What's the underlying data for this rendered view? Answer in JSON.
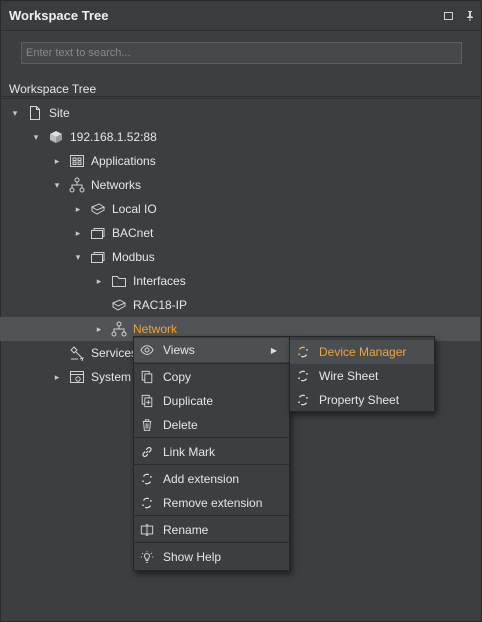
{
  "panel": {
    "title": "Workspace Tree",
    "search_placeholder": "Enter text to search...",
    "section_label": "Workspace Tree"
  },
  "tree": [
    {
      "label": "Site",
      "icon": "page-icon",
      "expanded": true
    },
    {
      "label": "192.168.1.52:88",
      "icon": "server-icon",
      "expanded": true
    },
    {
      "label": "Applications",
      "icon": "applications-icon",
      "expanded": false
    },
    {
      "label": "Networks",
      "icon": "network-icon",
      "expanded": true
    },
    {
      "label": "Local IO",
      "icon": "device-icon",
      "expanded": false
    },
    {
      "label": "BACnet",
      "icon": "stack-icon",
      "expanded": false
    },
    {
      "label": "Modbus",
      "icon": "stack-icon",
      "expanded": true
    },
    {
      "label": "Interfaces",
      "icon": "folder-icon",
      "expanded": false
    },
    {
      "label": "RAC18-IP",
      "icon": "device-icon",
      "expanded": false
    },
    {
      "label": "Network",
      "icon": "network-icon",
      "expanded": false
    },
    {
      "label": "Services",
      "icon": "services-icon",
      "expanded": false
    },
    {
      "label": "System",
      "icon": "system-icon",
      "expanded": false
    }
  ],
  "context_menu": {
    "items": [
      {
        "label": "Views",
        "icon": "eye-icon",
        "submenu": true
      },
      {
        "label": "Copy",
        "icon": "copy-icon"
      },
      {
        "label": "Duplicate",
        "icon": "duplicate-icon"
      },
      {
        "label": "Delete",
        "icon": "trash-icon"
      },
      {
        "label": "Link Mark",
        "icon": "link-icon"
      },
      {
        "label": "Add extension",
        "icon": "extension-icon"
      },
      {
        "label": "Remove extension",
        "icon": "extension-icon"
      },
      {
        "label": "Rename",
        "icon": "rename-icon"
      },
      {
        "label": "Show Help",
        "icon": "help-icon"
      }
    ]
  },
  "submenu": {
    "items": [
      {
        "label": "Device Manager",
        "icon": "view-icon",
        "selected": true
      },
      {
        "label": "Wire Sheet",
        "icon": "view-icon"
      },
      {
        "label": "Property Sheet",
        "icon": "view-icon"
      }
    ]
  },
  "colors": {
    "background": "#3c3f41",
    "accent": "#f0a23a",
    "highlight": "#515456"
  }
}
